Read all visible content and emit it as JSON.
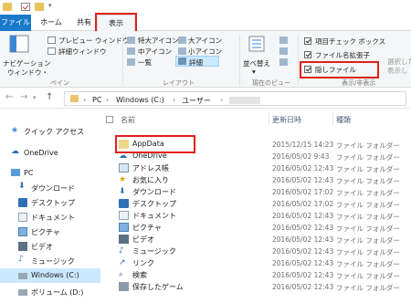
{
  "window": {
    "title": "⁠⁠",
    "title_visible": ""
  },
  "tabs": [
    "ファイル",
    "ホーム",
    "共有",
    "表示"
  ],
  "ribbon": {
    "pane_group": {
      "navigation_pane": [
        "ナビゲーション",
        "ウィンドウ・"
      ],
      "preview_pane": "プレビュー ウィンドウ",
      "details_pane": "詳細ウィンドウ",
      "label": "ペイン"
    },
    "layout_group": {
      "items": [
        "特大アイコン",
        "大アイコン",
        "中アイコン",
        "小アイコン",
        "一覧",
        "詳細"
      ],
      "label": "レイアウト"
    },
    "current_view_group": {
      "sort": [
        "並べ替え",
        ""
      ],
      "label": "現在のビュー"
    },
    "show_hide_group": {
      "item_checkbox": "項目チェック ボックス",
      "extensions": "ファイル名拡張子",
      "hidden_items": "隠しファイル",
      "label": "表示/非表示",
      "overflow": [
        "選択した",
        "表示し"
      ]
    }
  },
  "address": {
    "back": "←",
    "forward": "→",
    "up": "↑",
    "crumbs": [
      "PC",
      "Windows (C:)",
      "ユーザー"
    ]
  },
  "nav_pane": [
    "クイック アクセス",
    "OneDrive",
    "PC",
    "ダウンロード",
    "デスクトップ",
    "ドキュメント",
    "ピクチャ",
    "ビデオ",
    "ミュージック",
    "Windows (C:)",
    "ボリューム (D:)"
  ],
  "list": {
    "columns": [
      "名前",
      "更新日時",
      "種類"
    ],
    "rows": [
      {
        "name": "AppData",
        "date": "2015/12/15 14:23",
        "type": "ファイル フォルダー"
      },
      {
        "name": "OneDrive",
        "date": "2016/05/02 9:43",
        "type": "ファイル フォルダー"
      },
      {
        "name": "アドレス帳",
        "date": "2016/05/02 12:43",
        "type": "ファイル フォルダー"
      },
      {
        "name": "お気に入り",
        "date": "2016/05/02 12:43",
        "type": "ファイル フォルダー"
      },
      {
        "name": "ダウンロード",
        "date": "2016/05/02 17:02",
        "type": "ファイル フォルダー"
      },
      {
        "name": "デスクトップ",
        "date": "2016/05/02 17:02",
        "type": "ファイル フォルダー"
      },
      {
        "name": "ドキュメント",
        "date": "2016/05/02 12:43",
        "type": "ファイル フォルダー"
      },
      {
        "name": "ピクチャ",
        "date": "2016/05/02 12:43",
        "type": "ファイル フォルダー"
      },
      {
        "name": "ビデオ",
        "date": "2016/05/02 12:43",
        "type": "ファイル フォルダー"
      },
      {
        "name": "ミュージック",
        "date": "2016/05/02 12:43",
        "type": "ファイル フォルダー"
      },
      {
        "name": "リンク",
        "date": "2016/05/02 12:43",
        "type": "ファイル フォルダー"
      },
      {
        "name": "検索",
        "date": "2016/05/02 12:43",
        "type": "ファイル フォルダー"
      },
      {
        "name": "保存したゲーム",
        "date": "2016/05/02 12:43",
        "type": "ファイル フォルダー"
      }
    ]
  },
  "colors": {
    "accent": "#1979ca",
    "highlight": "#e0201b",
    "selected": "#cce8ff"
  }
}
